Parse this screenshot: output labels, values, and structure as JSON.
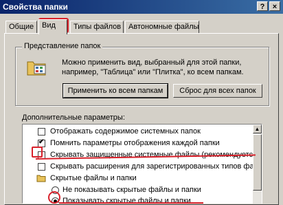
{
  "window": {
    "title": "Свойства папки",
    "help_label": "?",
    "close_label": "×"
  },
  "tabs": [
    {
      "label": "Общие",
      "active": false
    },
    {
      "label": "Вид",
      "active": true
    },
    {
      "label": "Типы файлов",
      "active": false
    },
    {
      "label": "Автономные файлы",
      "active": false
    }
  ],
  "folder_view": {
    "legend": "Представление папок",
    "description_line1": "Можно применить вид, выбранный для этой папки,",
    "description_line2": "например, \"Таблица\" или \"Плитка\", ко всем папкам.",
    "apply_all_label": "Применить ко всем папкам",
    "reset_all_label": "Сброс для всех папок",
    "icon": "folder-view-icon"
  },
  "advanced": {
    "label": "Дополнительные параметры:",
    "items": [
      {
        "kind": "checkbox",
        "checked": false,
        "text": "Отображать содержимое системных папок"
      },
      {
        "kind": "checkbox",
        "checked": true,
        "text": "Помнить параметры отображения каждой папки"
      },
      {
        "kind": "checkbox",
        "checked": false,
        "text": "Скрывать защищенные системные файлы (рекомендуется)"
      },
      {
        "kind": "checkbox",
        "checked": false,
        "text": "Скрывать расширения для зарегистрированных типов файлов"
      },
      {
        "kind": "folder",
        "text": "Скрытые файлы и папки"
      },
      {
        "kind": "radio",
        "checked": false,
        "text": "Не показывать скрытые файлы и папки"
      },
      {
        "kind": "radio",
        "checked": true,
        "text": "Показывать скрытые файлы и папки"
      }
    ]
  },
  "colors": {
    "accent_red": "#d8202a",
    "titlebar": "#0a246a",
    "face": "#d4d0c8"
  }
}
